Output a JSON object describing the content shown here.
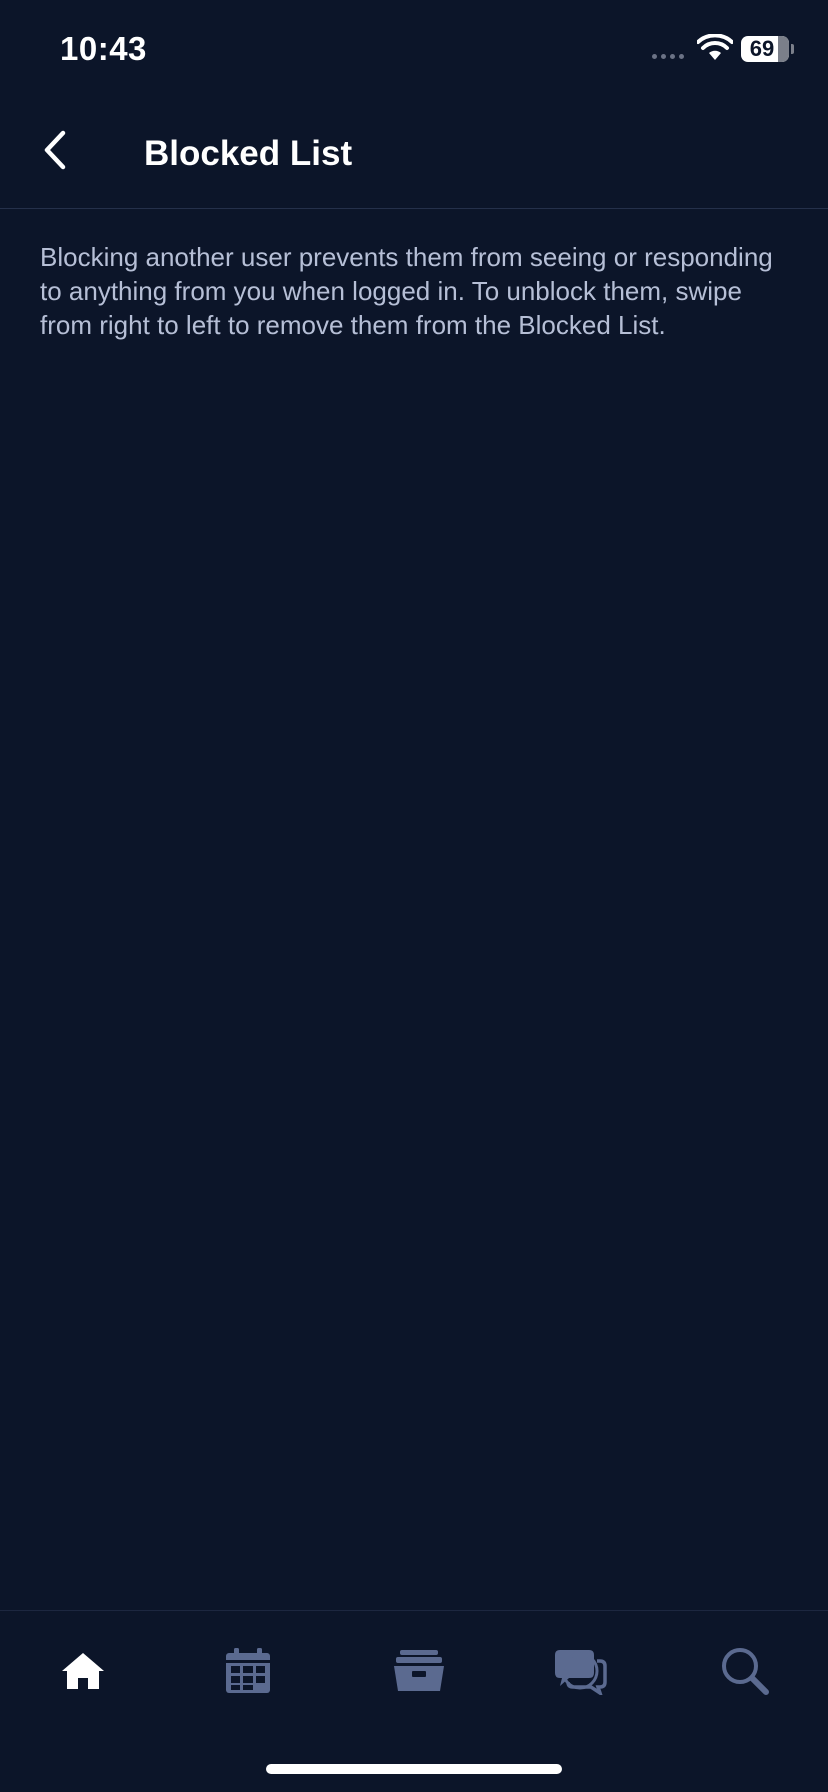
{
  "status_bar": {
    "time": "10:43",
    "battery_percent": "69"
  },
  "header": {
    "title": "Blocked List",
    "back_icon": "chevron-left-icon"
  },
  "content": {
    "description": "Blocking another user prevents them from seeing or responding to anything from you when logged in. To unblock them, swipe from right to left to remove them from the Blocked List."
  },
  "tab_bar": {
    "items": [
      {
        "icon": "home-icon",
        "active": true
      },
      {
        "icon": "calendar-icon",
        "active": false
      },
      {
        "icon": "inbox-tray-icon",
        "active": false
      },
      {
        "icon": "chat-icon",
        "active": false
      },
      {
        "icon": "search-icon",
        "active": false
      }
    ]
  },
  "colors": {
    "background": "#0c1529",
    "text_primary": "#ffffff",
    "text_secondary": "#b6bfd6",
    "icon_inactive": "#5b6a90",
    "icon_active": "#ffffff"
  }
}
